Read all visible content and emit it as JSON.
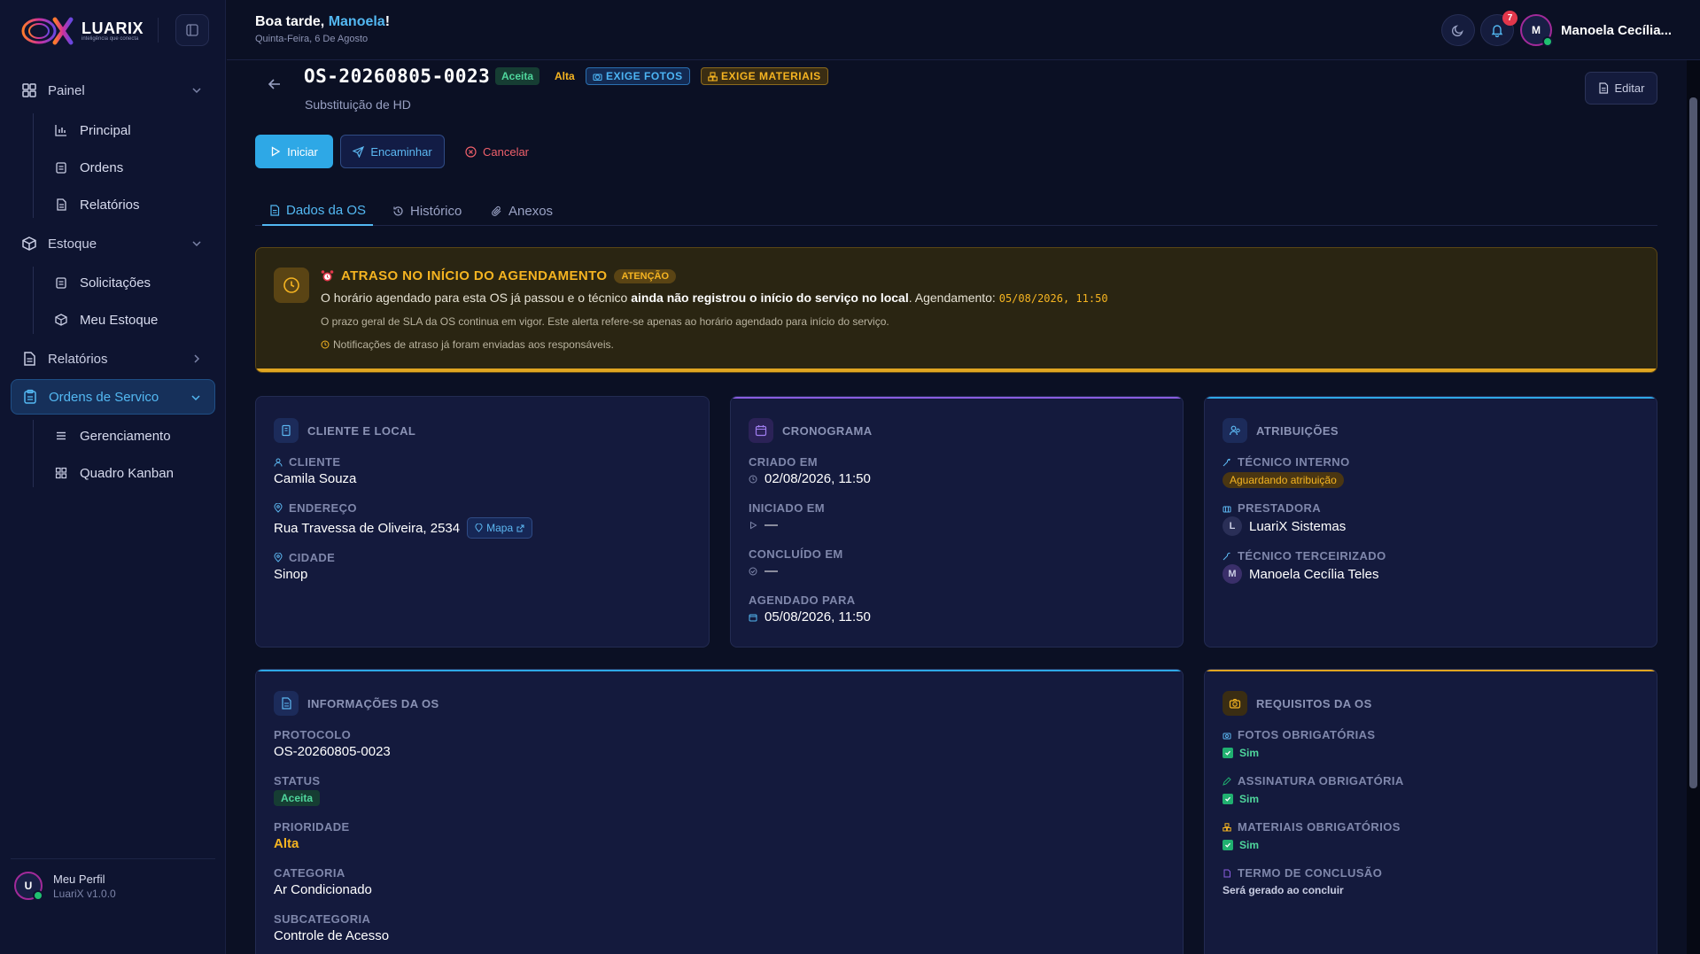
{
  "app": {
    "brand": "LUARIX",
    "tagline": "inteligência que conecta"
  },
  "sidebar": {
    "groups": [
      {
        "label": "Painel",
        "items": [
          "Principal",
          "Ordens",
          "Relatórios"
        ]
      },
      {
        "label": "Estoque",
        "items": [
          "Solicitações",
          "Meu Estoque"
        ]
      },
      {
        "label": "Relatórios",
        "items": []
      },
      {
        "label": "Ordens de Servico",
        "items": [
          "Gerenciamento",
          "Quadro Kanban"
        ]
      }
    ],
    "profile": {
      "initial": "U",
      "name": "Meu Perfil",
      "version": "LuariX v1.0.0"
    }
  },
  "header": {
    "greeting_prefix": "Boa tarde, ",
    "user_first_name": "Manoela",
    "greeting_suffix": "!",
    "date": "Quinta-Feira, 6 De Agosto",
    "notifications": "7",
    "user_initial": "M",
    "user_name": "Manoela Cecília..."
  },
  "os": {
    "code": "OS-20260805-0023",
    "status": "Aceita",
    "priority": "Alta",
    "req_photos": "EXIGE FOTOS",
    "req_materials": "EXIGE MATERIAIS",
    "description": "Substituição de HD",
    "edit_label": "Editar"
  },
  "actions": {
    "start": "Iniciar",
    "forward": "Encaminhar",
    "cancel": "Cancelar"
  },
  "tabs": [
    "Dados da OS",
    "Histórico",
    "Anexos"
  ],
  "alert": {
    "title": "ATRASO NO INÍCIO DO AGENDAMENTO",
    "tag": "ATENÇÃO",
    "text_a": "O horário agendado para esta OS já passou e o técnico ",
    "text_b": "ainda não registrou o início do serviço no local",
    "text_c": ". Agendamento: ",
    "schedule": "05/08/2026, 11:50",
    "note": "O prazo geral de SLA da OS continua em vigor. Este alerta refere-se apenas ao horário agendado para início do serviço.",
    "note2": "Notificações de atraso já foram enviadas aos responsáveis."
  },
  "client_card": {
    "title": "CLIENTE E LOCAL",
    "client_label": "CLIENTE",
    "client": "Camila Souza",
    "address_label": "ENDEREÇO",
    "address": "Rua Travessa de Oliveira, 2534",
    "map_label": "Mapa",
    "city_label": "CIDADE",
    "city": "Sinop"
  },
  "schedule_card": {
    "title": "CRONOGRAMA",
    "created_label": "CRIADO EM",
    "created": "02/08/2026, 11:50",
    "started_label": "INICIADO EM",
    "started": "—",
    "finished_label": "CONCLUÍDO EM",
    "finished": "—",
    "scheduled_label": "AGENDADO PARA",
    "scheduled": "05/08/2026, 11:50"
  },
  "assign_card": {
    "title": "ATRIBUIÇÕES",
    "internal_label": "TÉCNICO INTERNO",
    "internal": "Aguardando atribuição",
    "provider_label": "PRESTADORA",
    "provider_initial": "L",
    "provider": "LuariX Sistemas",
    "outsourced_label": "TÉCNICO TERCEIRIZADO",
    "outsourced_initial": "M",
    "outsourced": "Manoela Cecília Teles"
  },
  "info_card": {
    "title": "INFORMAÇÕES DA OS",
    "protocol_label": "PROTOCOLO",
    "protocol": "OS-20260805-0023",
    "status_label": "STATUS",
    "status": "Aceita",
    "priority_label": "PRIORIDADE",
    "priority": "Alta",
    "category_label": "CATEGORIA",
    "category": "Ar Condicionado",
    "subcategory_label": "SUBCATEGORIA",
    "subcategory": "Controle de Acesso"
  },
  "req_card": {
    "title": "REQUISITOS DA OS",
    "photos_label": "FOTOS OBRIGATÓRIAS",
    "photos": "Sim",
    "signature_label": "ASSINATURA OBRIGATÓRIA",
    "signature": "Sim",
    "materials_label": "MATERIAIS OBRIGATÓRIOS",
    "materials": "Sim",
    "term_label": "TERMO DE CONCLUSÃO",
    "term": "Será gerado ao concluir"
  },
  "colors": {
    "accent": "#53b8f2",
    "primary": "#2ea8e6",
    "warning": "#f5b421",
    "success": "#4fd69c",
    "danger": "#f0606b",
    "background": "#0b1024"
  }
}
